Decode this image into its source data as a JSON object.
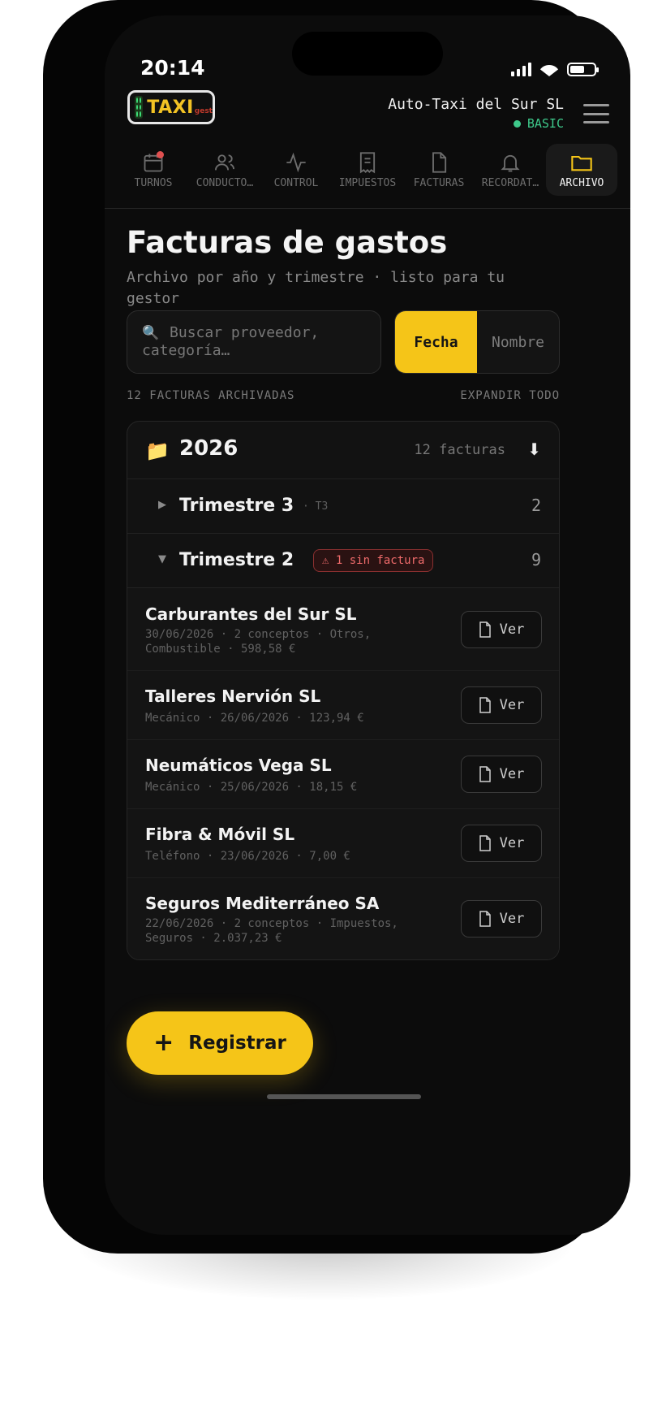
{
  "status_bar": {
    "time": "20:14"
  },
  "header": {
    "logo_text": "TAXI",
    "logo_sub": "gest",
    "company": "Auto-Taxi del Sur SL",
    "plan": "BASIC"
  },
  "tabs": [
    {
      "label": "TURNOS",
      "icon": "calendar-icon",
      "active": false,
      "badge": true
    },
    {
      "label": "CONDUCTO…",
      "icon": "users-icon",
      "active": false,
      "badge": false
    },
    {
      "label": "CONTROL",
      "icon": "activity-icon",
      "active": false,
      "badge": false
    },
    {
      "label": "IMPUESTOS",
      "icon": "receipt-icon",
      "active": false,
      "badge": false
    },
    {
      "label": "FACTURAS",
      "icon": "file-icon",
      "active": false,
      "badge": false
    },
    {
      "label": "RECORDAT…",
      "icon": "bell-icon",
      "active": false,
      "badge": false
    },
    {
      "label": "ARCHIVO",
      "icon": "folder-icon",
      "active": true,
      "badge": false
    }
  ],
  "page": {
    "title": "Facturas de gastos",
    "subtitle": "Archivo por año y trimestre · listo para tu gestor"
  },
  "search": {
    "placeholder": "Buscar proveedor, categoría…"
  },
  "sort": {
    "options": [
      "Fecha",
      "Nombre"
    ],
    "selected": "Fecha"
  },
  "summary": {
    "count_label": "12 FACTURAS ARCHIVADAS",
    "expand_label": "EXPANDIR TODO"
  },
  "archive": {
    "year": "2026",
    "year_count": "12 facturas",
    "quarters": [
      {
        "title": "Trimestre 3",
        "tag": "· T3",
        "count": "2",
        "expanded": false
      },
      {
        "title": "Trimestre 2",
        "warning": "⚠ 1 sin factura",
        "count": "9",
        "expanded": true
      }
    ],
    "invoices": [
      {
        "name": "Carburantes del Sur SL",
        "meta": "30/06/2026 · 2 conceptos · Otros, Combustible · 598,58 €",
        "button": "Ver"
      },
      {
        "name": "Talleres Nervión SL",
        "meta": "Mecánico · 26/06/2026 · 123,94 €",
        "button": "Ver"
      },
      {
        "name": "Neumáticos Vega SL",
        "meta": "Mecánico · 25/06/2026 · 18,15 €",
        "button": "Ver"
      },
      {
        "name": "Fibra & Móvil SL",
        "meta": "Teléfono · 23/06/2026 · 7,00 €",
        "button": "Ver"
      },
      {
        "name": "Seguros Mediterráneo SA",
        "meta": "22/06/2026 · 2 conceptos · Impuestos, Seguros · 2.037,23 €",
        "button": "Ver"
      }
    ]
  },
  "fab": {
    "label": "Registrar"
  },
  "colors": {
    "accent": "#f5c518",
    "background": "#0c0c0c",
    "plan": "#3ec98b",
    "warning": "#ef6b6b"
  }
}
